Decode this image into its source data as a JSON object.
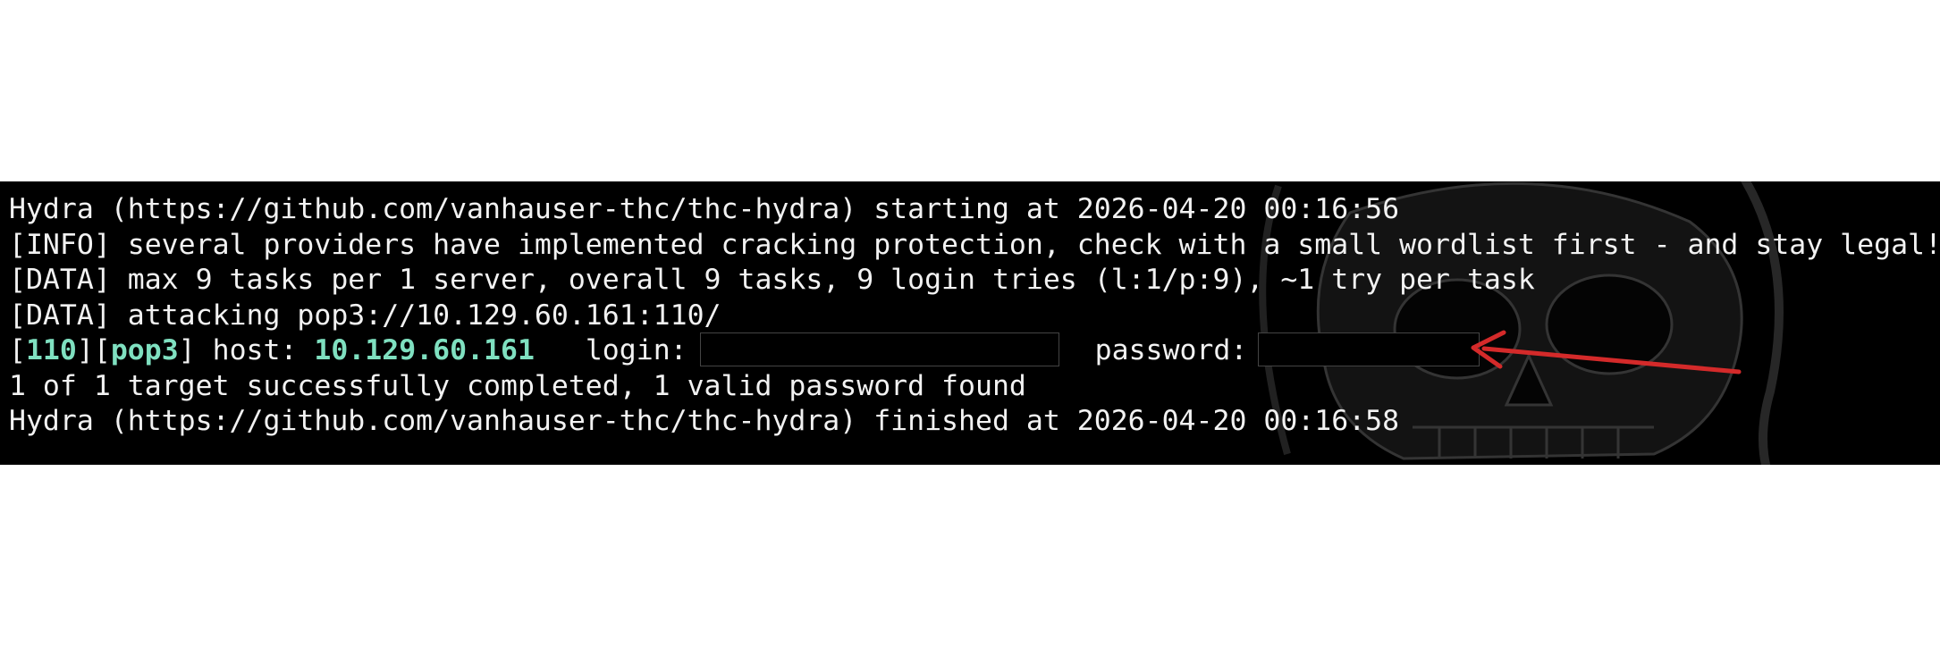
{
  "terminal": {
    "lines": {
      "start": "Hydra (https://github.com/vanhauser-thc/thc-hydra) starting at 2026-04-20 00:16:56",
      "info": "[INFO] several providers have implemented cracking protection, check with a small wordlist first - and stay legal!",
      "data_tasks": "[DATA] max 9 tasks per 1 server, overall 9 tasks, 9 login tries (l:1/p:9), ~1 try per task",
      "data_attack": "[DATA] attacking pop3://10.129.60.161:110/",
      "result": {
        "bracket_open_1": "[",
        "port": "110",
        "bracket_mid": "][",
        "service": "pop3",
        "bracket_close": "]",
        "host_label": " host: ",
        "host": "10.129.60.161",
        "login_label": "   login:",
        "password_label": "password:"
      },
      "summary": "1 of 1 target successfully completed, 1 valid password found",
      "finish": "Hydra (https://github.com/vanhauser-thc/thc-hydra) finished at 2026-04-20 00:16:58"
    }
  },
  "colors": {
    "terminal_bg": "#000000",
    "text": "#f2f2f2",
    "highlight": "#7fe0c0",
    "arrow": "#d42a2a"
  },
  "icons": {
    "background_art": "skull-icon",
    "annotation": "arrow-icon"
  }
}
